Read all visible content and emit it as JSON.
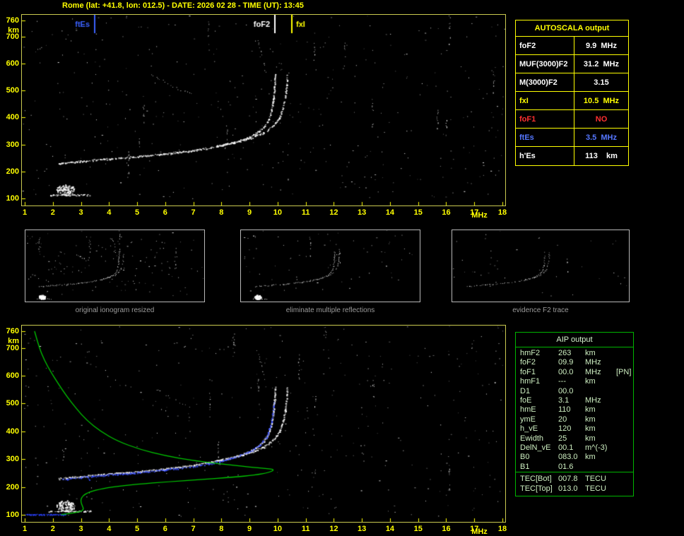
{
  "header": {
    "title": "Rome (lat: +41.8, lon: 012.5) - DATE: 2026 02 28 - TIME (UT): 13:45"
  },
  "autoscala": {
    "title": "AUTOSCALA output",
    "rows": [
      {
        "label": "foF2",
        "value": "9.9  MHz",
        "color": "#ffffff"
      },
      {
        "label": "MUF(3000)F2",
        "value": "31.2  MHz",
        "color": "#ffffff"
      },
      {
        "label": "M(3000)F2",
        "value": "3.15",
        "color": "#ffffff"
      },
      {
        "label": "fxI",
        "value": "10.5  MHz",
        "color": "#ffff00"
      },
      {
        "label": "foF1",
        "value": "NO",
        "color": "#ff3030"
      },
      {
        "label": "ftEs",
        "value": "3.5  MHz",
        "color": "#5577ff"
      },
      {
        "label": "h'Es",
        "value": "113    km",
        "color": "#ffffff"
      }
    ]
  },
  "aip": {
    "title": "AIP output",
    "rows": [
      {
        "label": "hmF2",
        "value": "263",
        "unit": "km",
        "extra": ""
      },
      {
        "label": "foF2",
        "value": "09.9",
        "unit": "MHz",
        "extra": ""
      },
      {
        "label": "foF1",
        "value": "00.0",
        "unit": "MHz",
        "extra": "[PN]"
      },
      {
        "label": "hmF1",
        "value": "---",
        "unit": "km",
        "extra": ""
      },
      {
        "label": "D1",
        "value": "00.0",
        "unit": "",
        "extra": ""
      },
      {
        "label": "foE",
        "value": "3.1",
        "unit": "MHz",
        "extra": ""
      },
      {
        "label": "hmE",
        "value": "110",
        "unit": "km",
        "extra": ""
      },
      {
        "label": "ymE",
        "value": "20",
        "unit": "km",
        "extra": ""
      },
      {
        "label": "h_vE",
        "value": "120",
        "unit": "km",
        "extra": ""
      },
      {
        "label": "Ewidth",
        "value": "25",
        "unit": "km",
        "extra": ""
      },
      {
        "label": "DelN_vE",
        "value": "00.1",
        "unit": "m^(-3)",
        "extra": ""
      },
      {
        "label": "B0",
        "value": "083.0",
        "unit": "km",
        "extra": ""
      },
      {
        "label": "B1",
        "value": "01.6",
        "unit": "",
        "extra": ""
      }
    ],
    "tec_rows": [
      {
        "label": "TEC[Bot]",
        "value": "007.8",
        "unit": "TECU"
      },
      {
        "label": "TEC[Top]",
        "value": "013.0",
        "unit": "TECU"
      }
    ]
  },
  "thumbnails": [
    {
      "caption": "original ionogram resized"
    },
    {
      "caption": "eliminate multiple reflections"
    },
    {
      "caption": "evidence F2 trace"
    }
  ],
  "chart_data": {
    "type": "scatter",
    "title": "Ionogram - Rome 2026-02-28 13:45 UT",
    "x_label": "MHz",
    "y_label": "km",
    "x_range": [
      1,
      18
    ],
    "y_range": [
      100,
      760
    ],
    "x_ticks": [
      1,
      2,
      3,
      4,
      5,
      6,
      7,
      8,
      9,
      10,
      11,
      12,
      13,
      14,
      15,
      16,
      17,
      18
    ],
    "y_ticks": [
      760,
      700,
      600,
      500,
      400,
      300,
      200,
      100
    ],
    "colors": {
      "axis": "#ffff00",
      "trace": "#ffffff",
      "profile": "#00c800",
      "restored": "#3a50ff",
      "fof2_marker": "#ffffff",
      "fxi_marker": "#ffff00",
      "ftes_marker": "#3b62ff"
    },
    "annotations": [
      {
        "label": "ftEs",
        "freq": 3.5,
        "color": "#3b62ff",
        "label_side": "left"
      },
      {
        "label": "foF2",
        "freq": 9.9,
        "color": "#ffffff",
        "label_side": "left"
      },
      {
        "label": "fxI",
        "freq": 10.5,
        "color": "#ffff00",
        "label_side": "right"
      }
    ],
    "traces": {
      "f2_ordinary": [
        [
          2.2,
          231
        ],
        [
          2.6,
          235
        ],
        [
          3.2,
          241
        ],
        [
          4.0,
          248
        ],
        [
          5.0,
          256
        ],
        [
          6.0,
          266
        ],
        [
          6.8,
          276
        ],
        [
          7.5,
          288
        ],
        [
          8.2,
          302
        ],
        [
          8.8,
          320
        ],
        [
          9.2,
          340
        ],
        [
          9.5,
          365
        ],
        [
          9.68,
          395
        ],
        [
          9.78,
          430
        ],
        [
          9.84,
          470
        ],
        [
          9.88,
          515
        ],
        [
          9.9,
          560
        ]
      ],
      "f2_extraordinary": [
        [
          7.8,
          295
        ],
        [
          8.4,
          308
        ],
        [
          9.0,
          324
        ],
        [
          9.5,
          345
        ],
        [
          9.85,
          372
        ],
        [
          10.05,
          400
        ],
        [
          10.18,
          435
        ],
        [
          10.26,
          475
        ],
        [
          10.31,
          520
        ],
        [
          10.33,
          558
        ]
      ],
      "es_line": [
        [
          1.85,
          114
        ],
        [
          3.35,
          114
        ]
      ],
      "es_blob": {
        "cx": 2.45,
        "cy": 133,
        "rx": 0.33,
        "ry": 20,
        "count": 90
      },
      "multiples": [
        [
          5.45,
          567
        ],
        [
          5.8,
          543
        ],
        [
          6.15,
          522
        ],
        [
          6.55,
          503
        ],
        [
          6.9,
          490
        ]
      ],
      "multiples2": [
        [
          9.25,
          695
        ],
        [
          9.4,
          645
        ],
        [
          9.5,
          600
        ],
        [
          9.58,
          565
        ]
      ],
      "restored_f2": [
        [
          2.35,
          228
        ],
        [
          3.0,
          236
        ],
        [
          4.0,
          245
        ],
        [
          5.0,
          253
        ],
        [
          6.0,
          263
        ],
        [
          7.0,
          274
        ],
        [
          7.8,
          290
        ],
        [
          8.5,
          308
        ],
        [
          9.0,
          328
        ],
        [
          9.35,
          352
        ],
        [
          9.6,
          382
        ],
        [
          9.73,
          418
        ],
        [
          9.81,
          460
        ],
        [
          9.86,
          505
        ]
      ],
      "restored_e": [
        [
          1.0,
          102
        ],
        [
          2.45,
          102
        ]
      ],
      "blue_fragment": [
        [
          3.25,
          230
        ],
        [
          3.45,
          218
        ]
      ]
    },
    "profile": [
      [
        1.35,
        760
      ],
      [
        1.5,
        705
      ],
      [
        1.7,
        655
      ],
      [
        1.95,
        610
      ],
      [
        2.2,
        570
      ],
      [
        2.5,
        525
      ],
      [
        2.85,
        480
      ],
      [
        3.2,
        440
      ],
      [
        3.7,
        400
      ],
      [
        4.3,
        365
      ],
      [
        5.1,
        335
      ],
      [
        6.0,
        312
      ],
      [
        7.0,
        295
      ],
      [
        8.0,
        283
      ],
      [
        9.0,
        272
      ],
      [
        9.6,
        266
      ],
      [
        9.9,
        263
      ],
      [
        9.7,
        252
      ],
      [
        9.2,
        243
      ],
      [
        8.4,
        235
      ],
      [
        7.3,
        227
      ],
      [
        6.1,
        219
      ],
      [
        5.0,
        210
      ],
      [
        4.1,
        200
      ],
      [
        3.5,
        189
      ],
      [
        3.15,
        175
      ],
      [
        3.0,
        160
      ],
      [
        3.0,
        145
      ],
      [
        3.05,
        132
      ],
      [
        3.1,
        120
      ],
      [
        3.0,
        112
      ],
      [
        2.7,
        106
      ],
      [
        2.3,
        101
      ]
    ]
  }
}
